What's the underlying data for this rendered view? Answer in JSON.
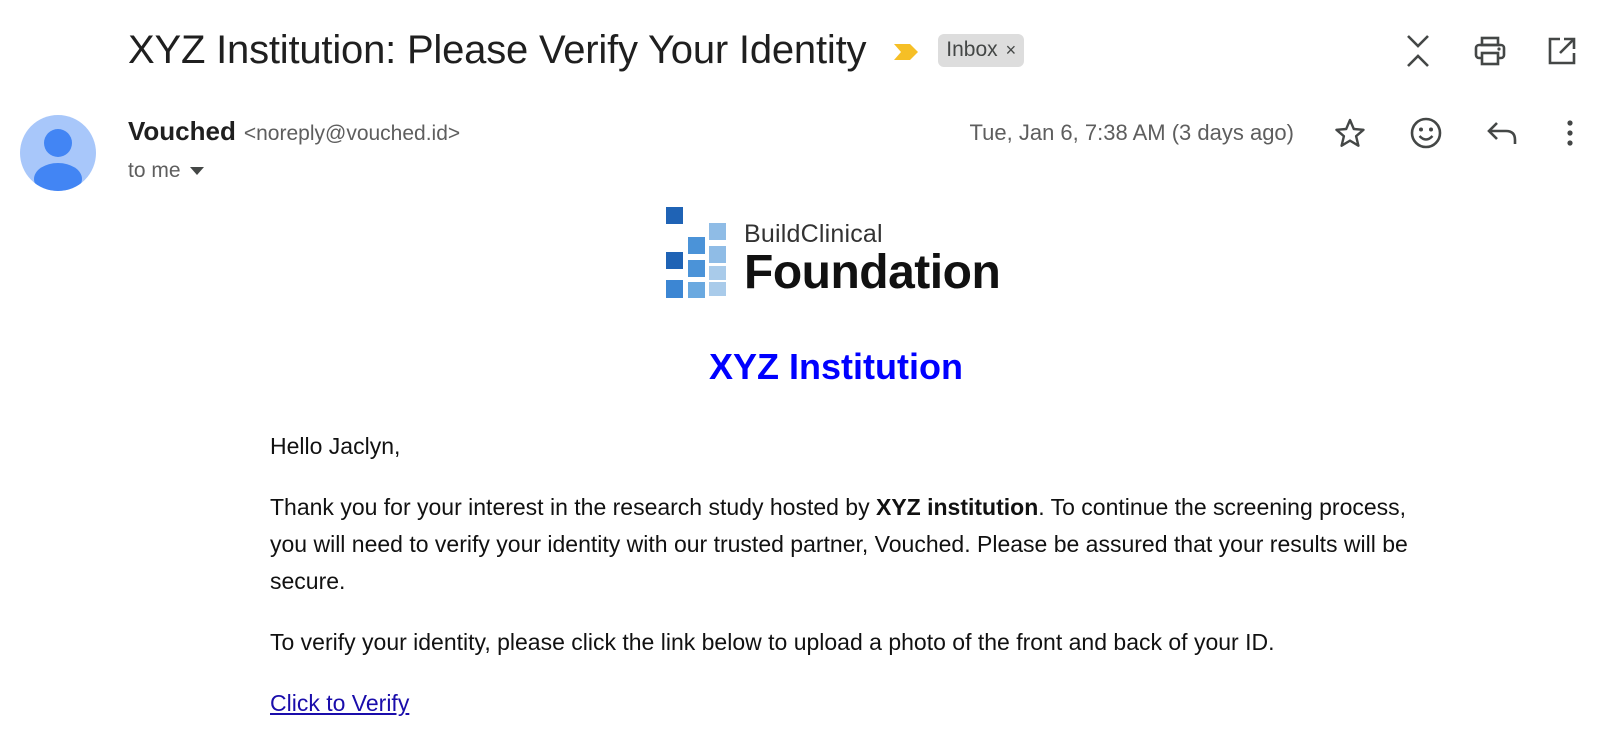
{
  "email": {
    "subject": "XYZ Institution: Please Verify Your Identity",
    "label": "Inbox",
    "label_remove": "×",
    "sender": {
      "name": "Vouched",
      "email": "<noreply@vouched.id>"
    },
    "recipient": "to me",
    "date": "Tue, Jan 6, 7:38 AM (3 days ago)"
  },
  "icons": {
    "importance": "importance-marker-icon",
    "collapse": "collapse-all-icon",
    "print": "print-icon",
    "popout": "open-in-new-window-icon",
    "star": "star-icon",
    "emoji": "emoji-reaction-icon",
    "reply": "reply-icon",
    "more": "more-vertical-icon",
    "avatar": "default-avatar-icon",
    "dropdown": "caret-down-icon"
  },
  "body": {
    "logo": {
      "small_text": "BuildClinical",
      "big_text": "Foundation"
    },
    "institution_heading": "XYZ Institution",
    "greeting": "Hello Jaclyn,",
    "para2_before": "Thank you for your interest in the research study hosted by ",
    "para2_bold": "XYZ institution",
    "para2_after": ". To continue the screening process, you will need to verify your identity with our trusted partner, Vouched. Please be assured that your results will be secure.",
    "para3": "To verify your identity, please click the link below to upload a photo of the front and back of your ID.",
    "link": "Click to Verify"
  },
  "colors": {
    "importance": "#f6bf26",
    "heading_blue": "#0000ff",
    "link": "#1a0dab",
    "avatar_bg": "#a8c7fa",
    "avatar_fg": "#4285f4",
    "chip_bg": "#dddddd"
  }
}
